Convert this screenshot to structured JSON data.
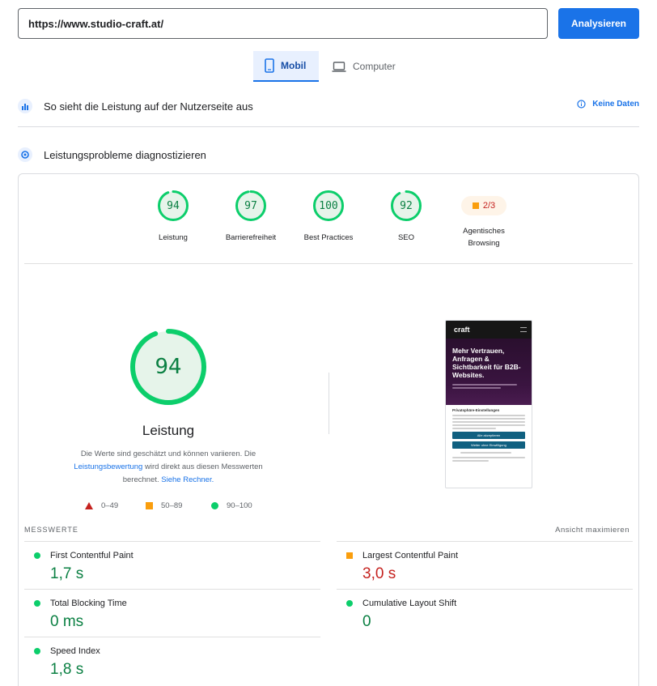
{
  "url_input": {
    "value": "https://www.studio-craft.at/"
  },
  "analyze_button": {
    "label": "Analysieren"
  },
  "device_tabs": {
    "mobile": "Mobil",
    "desktop": "Computer"
  },
  "field_data": {
    "title": "So sieht die Leistung auf der Nutzerseite aus",
    "no_data": "Keine Daten"
  },
  "lab_data": {
    "title": "Leistungsprobleme diagnostizieren"
  },
  "categories": [
    {
      "score": "94",
      "value": 94,
      "label": "Leistung"
    },
    {
      "score": "97",
      "value": 97,
      "label": "Barrierefreiheit"
    },
    {
      "score": "100",
      "value": 100,
      "label": "Best Practices"
    },
    {
      "score": "92",
      "value": 92,
      "label": "SEO"
    }
  ],
  "agentic": {
    "score": "2/3",
    "label_line1": "Agentisches",
    "label_line2": "Browsing"
  },
  "main_score": {
    "score": "94",
    "value": 94,
    "title": "Leistung",
    "desc_part1": "Die Werte sind geschätzt und können variieren. Die",
    "desc_link1": "Leistungsbewertung",
    "desc_part2": " wird direkt aus diesen Messwerten berechnet. ",
    "desc_link2": "Siehe Rechner."
  },
  "legend": {
    "low": "0–49",
    "mid": "50–89",
    "high": "90–100"
  },
  "screenshot": {
    "logo": "craft",
    "headline": "Mehr Vertrauen, Anfragen & Sichtbarkeit für B2B-Websites.",
    "privacy_title": "Privatsphäre-Einstellungen",
    "btn1": "Alle akzeptieren",
    "btn2": "Weiter ohne Einwilligung"
  },
  "metrics_header": {
    "title": "MESSWERTE",
    "maximize": "Ansicht maximieren"
  },
  "metrics": {
    "fcp": {
      "label": "First Contentful Paint",
      "value": "1,7 s"
    },
    "lcp": {
      "label": "Largest Contentful Paint",
      "value": "3,0 s"
    },
    "tbt": {
      "label": "Total Blocking Time",
      "value": "0 ms"
    },
    "cls": {
      "label": "Cumulative Layout Shift",
      "value": "0"
    },
    "si": {
      "label": "Speed Index",
      "value": "1,8 s"
    }
  },
  "colors": {
    "accent": "#1a73e8",
    "pass": "#0cce6b",
    "average": "#fa9e0d",
    "fail": "#c5221f"
  }
}
